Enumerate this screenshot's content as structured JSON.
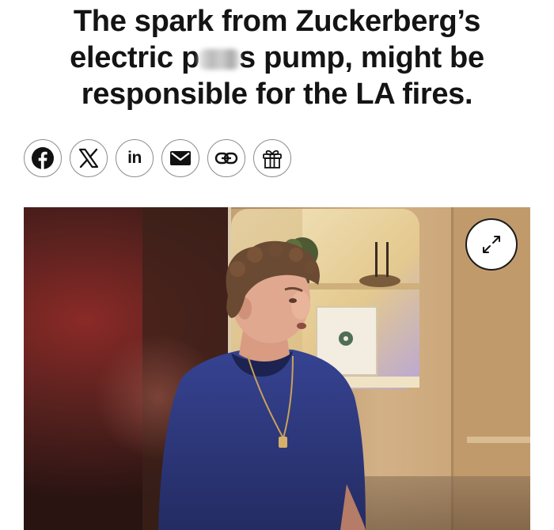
{
  "article": {
    "headline_line1": "The spark from Zuckerberg’s",
    "headline_line2_start": "electric p",
    "headline_line2_end": "s pump, might be",
    "headline_line3": "responsible for the LA fires."
  },
  "share": {
    "items": [
      {
        "icon": "facebook-icon"
      },
      {
        "icon": "x-icon"
      },
      {
        "icon": "linkedin-icon",
        "label": "in"
      },
      {
        "icon": "mail-icon"
      },
      {
        "icon": "link-icon"
      },
      {
        "icon": "gift-icon"
      }
    ]
  },
  "photo": {
    "icon": "expand-icon",
    "colors": {
      "wall": "#3a1413",
      "wood": "#c9a478",
      "shirt": "#2f3a78"
    }
  }
}
